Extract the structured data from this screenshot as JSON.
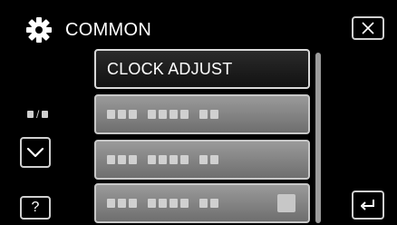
{
  "header": {
    "title": "COMMON",
    "icon": "gear-icon"
  },
  "menu": {
    "items": [
      {
        "label": "CLOCK ADJUST",
        "selected": true
      },
      {
        "label": "",
        "legible": false
      },
      {
        "label": "",
        "legible": false
      },
      {
        "label": "",
        "legible": false
      }
    ]
  },
  "controls": {
    "close_icon": "close-icon",
    "down_icon": "chevron-down-icon",
    "help_label": "?",
    "return_icon": "return-icon",
    "page_indicator_separator": "/"
  },
  "colors": {
    "background": "#000000",
    "button_border": "#cfcfcf",
    "item_gray": "#8a8a8a",
    "item_active": "#1e1e1e"
  }
}
